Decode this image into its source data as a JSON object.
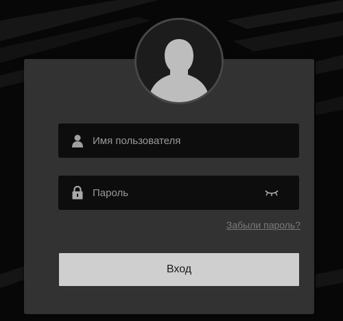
{
  "login_form": {
    "username_placeholder": "Имя пользователя",
    "password_placeholder": "Пароль",
    "forgot_password_link": "Забыли пароль?",
    "submit_label": "Вход"
  },
  "icons": {
    "avatar": "user-silhouette-icon",
    "username": "user-icon",
    "password": "lock-icon",
    "show_password": "eye-closed-icon"
  },
  "colors": {
    "background": "#070707",
    "panel": "#323232",
    "field": "#0d0d0d",
    "button": "#cfcfcf",
    "placeholder_text": "#9a9a9a",
    "link_text": "#7a7a7a"
  }
}
